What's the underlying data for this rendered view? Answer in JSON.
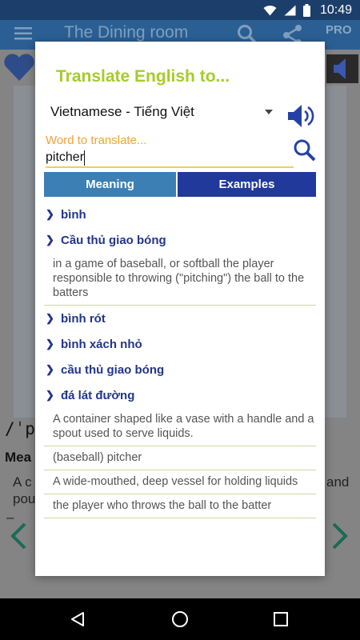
{
  "status_bar": {
    "time": "10:49",
    "icons": [
      "wifi-icon",
      "signal-icon",
      "battery-icon"
    ]
  },
  "app_bar": {
    "title": "The Dining room",
    "pro_label": "PRO"
  },
  "background_page": {
    "pronunciation": "/ˈpr",
    "meaning_label": "Mea",
    "line1": "A c",
    "line1_end": "and",
    "line2": "pou",
    "dash": "–"
  },
  "dialog": {
    "title": "Translate English to...",
    "language": "Vietnamese - Tiếng Việt",
    "search_label": "Word to translate...",
    "search_value": "pitcher",
    "tabs": [
      {
        "label": "Meaning"
      },
      {
        "label": "Examples"
      }
    ],
    "results": [
      {
        "type": "group",
        "text": "bình"
      },
      {
        "type": "group",
        "text": "Cầu thủ giao bóng"
      },
      {
        "type": "definition",
        "text": "in a game of baseball, or softball the player responsible to throwing (\"pitching\") the ball to the batters"
      },
      {
        "type": "group",
        "text": "bình rót"
      },
      {
        "type": "group",
        "text": "bình xách nhỏ"
      },
      {
        "type": "group",
        "text": "cầu thủ giao bóng"
      },
      {
        "type": "group",
        "text": "đá lát đường"
      },
      {
        "type": "definition",
        "text": "A container shaped like a vase with a handle and a spout used to serve liquids."
      },
      {
        "type": "definition",
        "text": "(baseball) pitcher"
      },
      {
        "type": "definition",
        "text": "A wide-mouthed, deep vessel for holding liquids"
      },
      {
        "type": "definition",
        "text": "the player who throws the ball to the batter"
      }
    ]
  },
  "colors": {
    "accent_title": "#a6cc2a",
    "label_orange": "#f2a23a",
    "tab_meaning": "#3b7fb4",
    "tab_examples": "#22399c",
    "result_blue": "#22358a"
  }
}
